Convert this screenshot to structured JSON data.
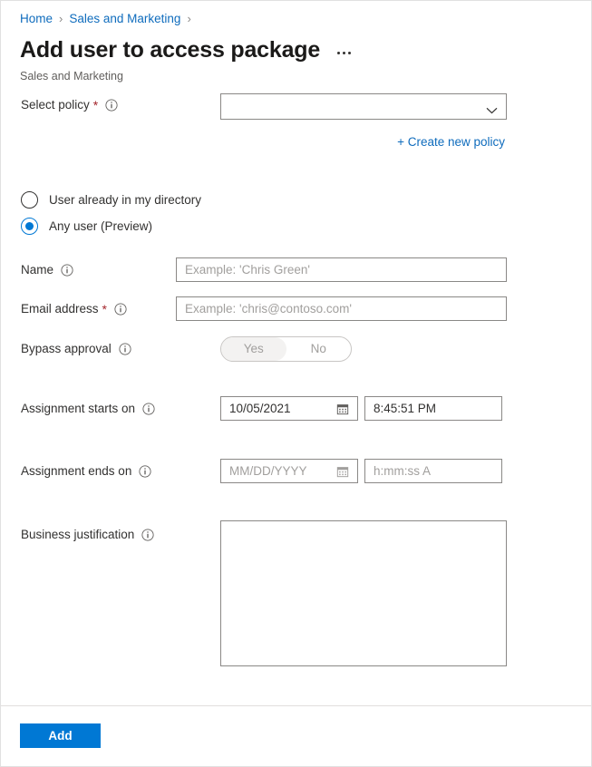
{
  "breadcrumb": {
    "items": [
      {
        "label": "Home"
      },
      {
        "label": "Sales and Marketing"
      }
    ],
    "separator": "›"
  },
  "header": {
    "title": "Add user to access package",
    "subtitle": "Sales and Marketing",
    "more_menu": "more-commands"
  },
  "form": {
    "policy": {
      "label": "Select policy",
      "required_marker": "*",
      "value": "",
      "placeholder": "",
      "create_link": "+ Create new policy"
    },
    "user_scope": {
      "options": [
        {
          "label": "User already in my directory",
          "selected": false
        },
        {
          "label": "Any user (Preview)",
          "selected": true
        }
      ]
    },
    "name": {
      "label": "Name",
      "value": "",
      "placeholder": "Example: 'Chris Green'"
    },
    "email": {
      "label": "Email address",
      "required_marker": "*",
      "value": "",
      "placeholder": "Example: 'chris@contoso.com'"
    },
    "bypass_approval": {
      "label": "Bypass approval",
      "on_label": "Yes",
      "off_label": "No",
      "selected": "Yes"
    },
    "assignment_starts": {
      "label": "Assignment starts on",
      "date_value": "10/05/2021",
      "date_placeholder": "MM/DD/YYYY",
      "time_value": "8:45:51 PM",
      "time_placeholder": "h:mm:ss A"
    },
    "assignment_ends": {
      "label": "Assignment ends on",
      "date_value": "",
      "date_placeholder": "MM/DD/YYYY",
      "time_value": "",
      "time_placeholder": "h:mm:ss A"
    },
    "justification": {
      "label": "Business justification",
      "value": "",
      "placeholder": ""
    }
  },
  "footer": {
    "submit_label": "Add"
  },
  "colors": {
    "accent": "#0078d4",
    "link": "#0f6cbd",
    "required": "#a4262c",
    "text": "#323130",
    "placeholder": "#a19f9d",
    "border": "#8a8886"
  }
}
